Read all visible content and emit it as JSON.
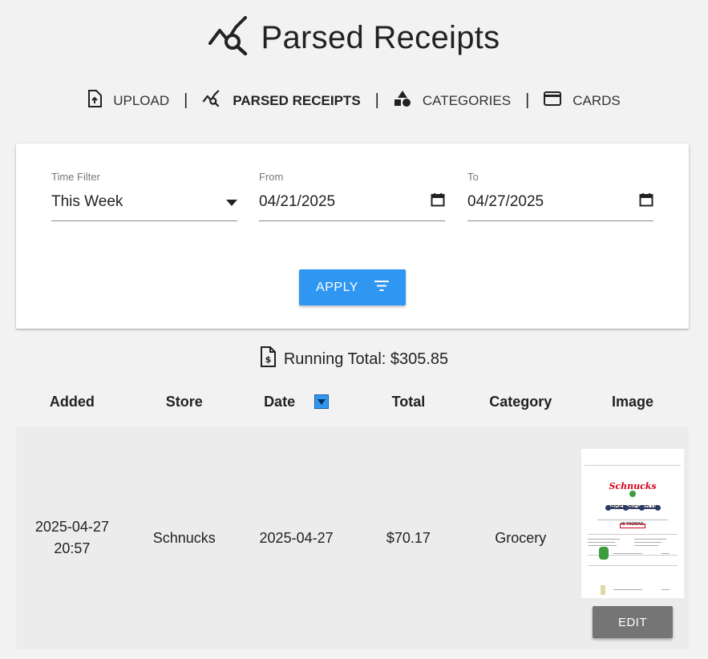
{
  "page": {
    "title": "Parsed Receipts"
  },
  "nav": {
    "items": [
      {
        "label": "UPLOAD",
        "icon": "upload-file-icon"
      },
      {
        "label": "PARSED RECEIPTS",
        "icon": "analytics-search-icon",
        "active": true
      },
      {
        "label": "CATEGORIES",
        "icon": "category-shapes-icon"
      },
      {
        "label": "CARDS",
        "icon": "credit-card-icon"
      }
    ],
    "separator": "|"
  },
  "filters": {
    "time_filter": {
      "label": "Time Filter",
      "value": "This Week"
    },
    "from": {
      "label": "From",
      "value": "04/21/2025"
    },
    "to": {
      "label": "To",
      "value": "04/27/2025"
    },
    "apply_label": "APPLY"
  },
  "summary": {
    "running_total": "Running Total: $305.85"
  },
  "table": {
    "headers": [
      "Added",
      "Store",
      "Date",
      "Total",
      "Category",
      "Image"
    ],
    "rows": [
      {
        "added_date": "2025-04-27",
        "added_time": "20:57",
        "store": "Schnucks",
        "date": "2025-04-27",
        "total": "$70.17",
        "category": "Grocery",
        "edit_label": "EDIT",
        "receipt": {
          "brand": "Schnucks",
          "heading": "ORDER PICKED UP",
          "greeting": "HI THOMAS,"
        }
      }
    ]
  },
  "colors": {
    "accent": "#2f96f1",
    "edit_button": "#757575",
    "brand_red": "#d0021b"
  }
}
